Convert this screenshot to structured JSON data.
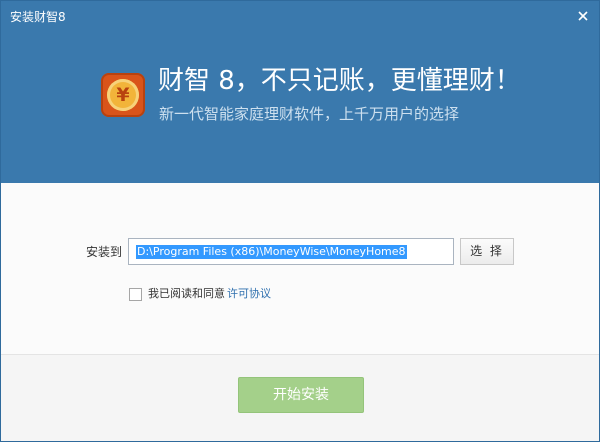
{
  "window": {
    "title": "安装财智8"
  },
  "header": {
    "headline": "财智 8，不只记账，更懂理财！",
    "subline": "新一代智能家庭理财软件，上千万用户的选择",
    "logo_glyph": "¥"
  },
  "install": {
    "path_label": "安装到",
    "path_value": "D:\\Program Files (x86)\\MoneyWise\\MoneyHome8",
    "browse_label": "选 择",
    "agree_label": "我已阅读和同意",
    "license_link": "许可协议",
    "agree_checked": false,
    "start_label": "开始安装"
  },
  "colors": {
    "header_bg": "#3a79ad",
    "logo_bg": "#d9541a",
    "install_button": "#a4d08a",
    "link": "#2e6fae"
  },
  "icons": {
    "close": "close-icon",
    "logo": "money-logo-icon"
  }
}
